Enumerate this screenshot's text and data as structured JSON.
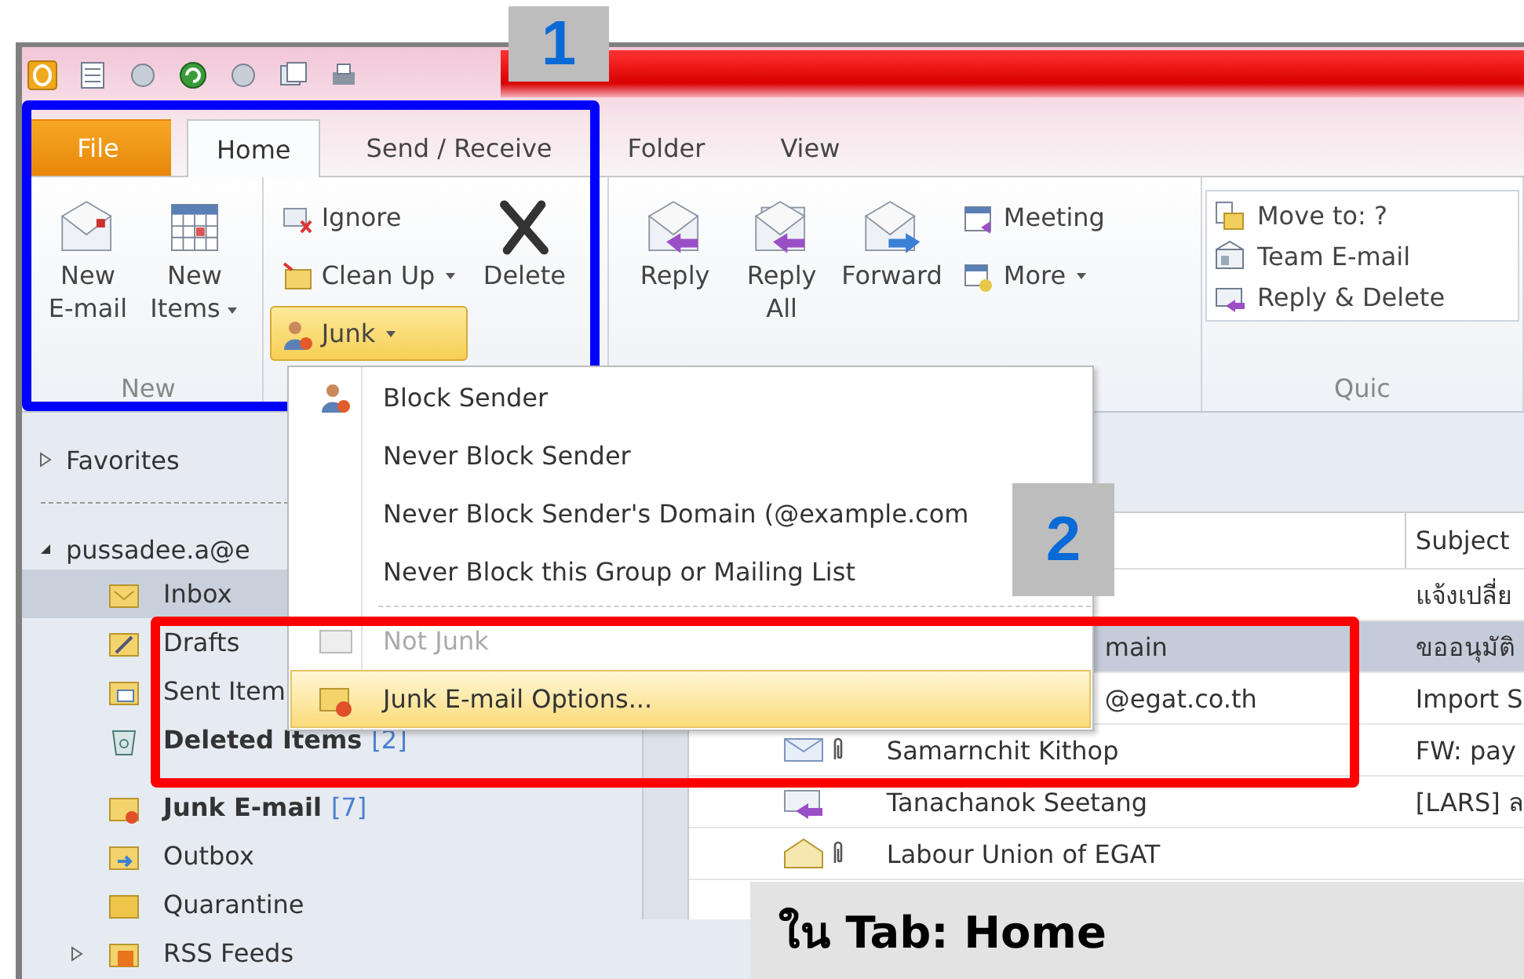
{
  "tabs": [
    {
      "label": "File",
      "kind": "backstage",
      "selected": false
    },
    {
      "label": "Home",
      "kind": "tab",
      "selected": true
    },
    {
      "label": "Send / Receive",
      "kind": "tab",
      "selected": false
    },
    {
      "label": "Folder",
      "kind": "tab",
      "selected": false
    },
    {
      "label": "View",
      "kind": "tab",
      "selected": false
    }
  ],
  "ribbon": {
    "groups": [
      {
        "label": "New",
        "items": [
          {
            "kind": "large",
            "label": "New\nE-mail",
            "dropdown": false
          },
          {
            "kind": "large",
            "label": "New\nItems",
            "dropdown": true
          }
        ]
      },
      {
        "items": [
          {
            "kind": "small",
            "label": "Ignore",
            "dropdown": false,
            "pressed": false
          },
          {
            "kind": "small",
            "label": "Clean Up",
            "dropdown": true,
            "pressed": false
          },
          {
            "kind": "small",
            "label": "Junk",
            "dropdown": true,
            "pressed": true
          },
          {
            "kind": "large",
            "label": "Delete",
            "dropdown": false
          }
        ]
      },
      {
        "items": [
          {
            "kind": "large",
            "label": "Reply",
            "dropdown": false
          },
          {
            "kind": "large",
            "label": "Reply\nAll",
            "dropdown": false
          },
          {
            "kind": "large",
            "label": "Forward",
            "dropdown": false
          },
          {
            "kind": "small",
            "label": "Meeting",
            "dropdown": false,
            "pressed": false
          },
          {
            "kind": "small",
            "label": "More",
            "dropdown": true,
            "pressed": false
          }
        ]
      },
      {
        "label": "Quic",
        "items": [
          {
            "kind": "gallery",
            "label": "Move to: ?"
          },
          {
            "kind": "gallery",
            "label": "Team E-mail"
          },
          {
            "kind": "gallery",
            "label": "Reply & Delete"
          }
        ]
      }
    ]
  },
  "junk_menu": [
    {
      "label": "Block Sender",
      "kind": "item",
      "disabled": false,
      "selected": false
    },
    {
      "label": "Never Block Sender",
      "kind": "item",
      "disabled": false,
      "selected": false
    },
    {
      "label": "Never Block Sender's Domain (@example.com",
      "kind": "item",
      "disabled": false,
      "selected": false
    },
    {
      "label": "Never Block this Group or Mailing List",
      "kind": "item",
      "disabled": false,
      "selected": false
    },
    {
      "kind": "separator"
    },
    {
      "label": "Not Junk",
      "kind": "item",
      "disabled": true,
      "selected": false
    },
    {
      "label": "Junk E-mail Options...",
      "kind": "item",
      "disabled": false,
      "selected": true
    }
  ],
  "navigation": {
    "favorites": {
      "label": "Favorites",
      "expanded": false
    },
    "account": {
      "label": "pussadee.a@e",
      "expanded": true
    },
    "folders": [
      {
        "label": "Inbox",
        "selected": true,
        "unread": false
      },
      {
        "label": "Drafts",
        "selected": false,
        "unread": false
      },
      {
        "label": "Sent Item",
        "selected": false,
        "unread": false
      },
      {
        "label": "Deleted Items",
        "selected": false,
        "unread": true,
        "count": "[2]"
      },
      {
        "label": "Junk E-mail",
        "selected": false,
        "unread": true,
        "count": "[7]"
      },
      {
        "label": "Outbox",
        "selected": false,
        "unread": false
      },
      {
        "label": "Quarantine",
        "selected": false,
        "unread": false
      },
      {
        "label": "RSS Feeds",
        "selected": false,
        "unread": false,
        "expanded": false
      }
    ]
  },
  "message_list": {
    "columns": [
      "Subject"
    ],
    "rows": [
      {
        "subject": "แจ้งเปลี่ย",
        "selected": false
      },
      {
        "from": "main",
        "subject": "ขออนุมัติ",
        "selected": true
      },
      {
        "from": "@egat.co.th",
        "subject": "Import S",
        "selected": false
      },
      {
        "from": "Samarnchit Kithop",
        "subject": "FW: pay",
        "attachment": true,
        "selected": false
      },
      {
        "from": "Tanachanok Seetang",
        "subject": "[LARS] ล",
        "attachment": false,
        "selected": false
      },
      {
        "from": "Labour Union of EGAT",
        "attachment": true,
        "selected": false
      }
    ]
  },
  "annotations": {
    "steps": [
      "1",
      "2"
    ],
    "caption": "ใน Tab: Home"
  }
}
